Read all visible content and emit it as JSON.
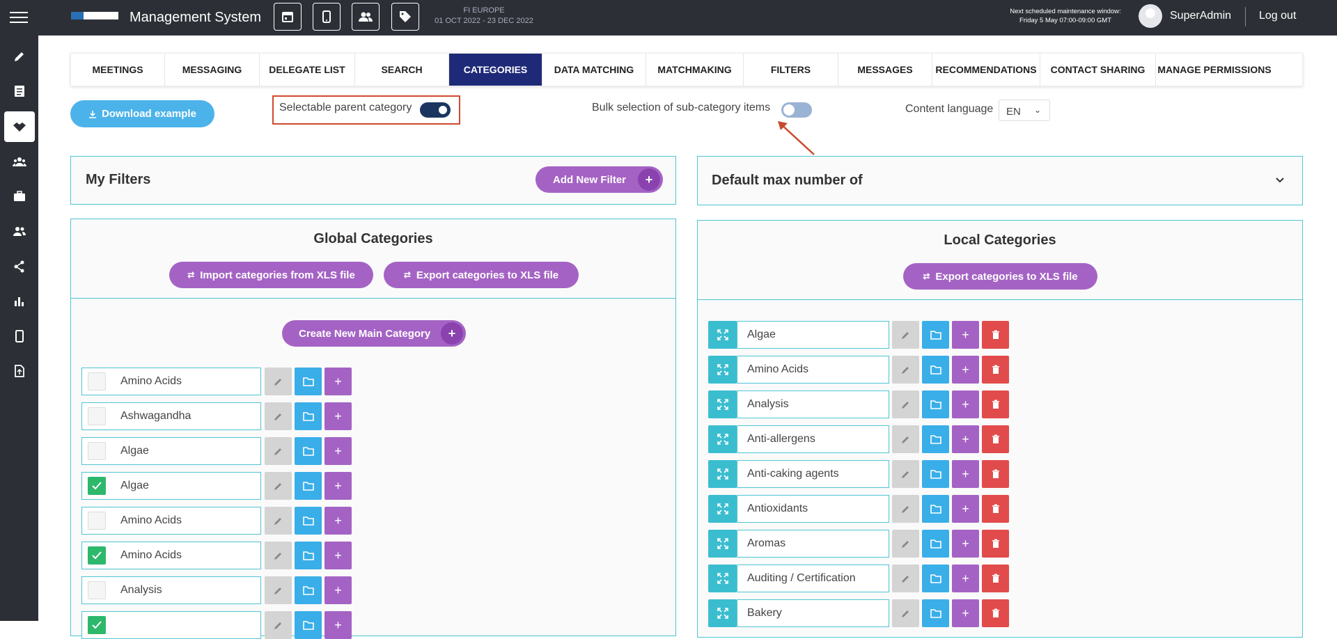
{
  "header": {
    "app_title": "Management System",
    "event_name": "FI EUROPE",
    "event_dates": "01 OCT 2022 - 23 DEC 2022",
    "maintenance_label": "Next scheduled maintenance window:",
    "maintenance_time": "Friday 5 May 07:00-09:00 GMT",
    "user_name": "SuperAdmin",
    "logout_label": "Log out"
  },
  "tabs": [
    "MEETINGS",
    "MESSAGING",
    "DELEGATE LIST",
    "SEARCH",
    "CATEGORIES",
    "DATA MATCHING",
    "MATCHMAKING",
    "FILTERS",
    "MESSAGES",
    "RECOMMENDATIONS",
    "CONTACT SHARING",
    "MANAGE PERMISSIONS"
  ],
  "active_tab": "CATEGORIES",
  "controls": {
    "download_label": "Download example",
    "selectable_parent_label": "Selectable parent category",
    "selectable_parent_on": true,
    "bulk_selection_label": "Bulk selection of sub-category items",
    "bulk_selection_on": false,
    "content_language_label": "Content language",
    "content_language_value": "EN"
  },
  "my_filters": {
    "title": "My Filters",
    "add_label": "Add New Filter"
  },
  "default_max": {
    "title": "Default max number of"
  },
  "global": {
    "title": "Global Categories",
    "import_label": "Import categories from XLS file",
    "export_label": "Export categories to XLS file",
    "create_label": "Create New Main Category",
    "items": [
      {
        "name": "Amino Acids",
        "checked": false
      },
      {
        "name": "Ashwagandha",
        "checked": false
      },
      {
        "name": "Algae",
        "checked": false
      },
      {
        "name": "Algae",
        "checked": true
      },
      {
        "name": "Amino Acids",
        "checked": false
      },
      {
        "name": "Amino Acids",
        "checked": true
      },
      {
        "name": "Analysis",
        "checked": false
      },
      {
        "name": "",
        "checked": true
      }
    ]
  },
  "local": {
    "title": "Local Categories",
    "export_label": "Export categories to XLS file",
    "items": [
      "Algae",
      "Amino Acids",
      "Analysis",
      "Anti-allergens",
      "Anti-caking agents",
      "Antioxidants",
      "Aromas",
      "Auditing / Certification",
      "Bakery"
    ]
  },
  "colors": {
    "sidebar": "#2c3036",
    "active_tab": "#1e2a78",
    "accent_purple": "#a463c4",
    "accent_blue": "#3aaee8",
    "panel_border": "#4ec5d4",
    "delete_red": "#e14b4b",
    "check_green": "#2db86c",
    "highlight_border": "#d1492f"
  }
}
